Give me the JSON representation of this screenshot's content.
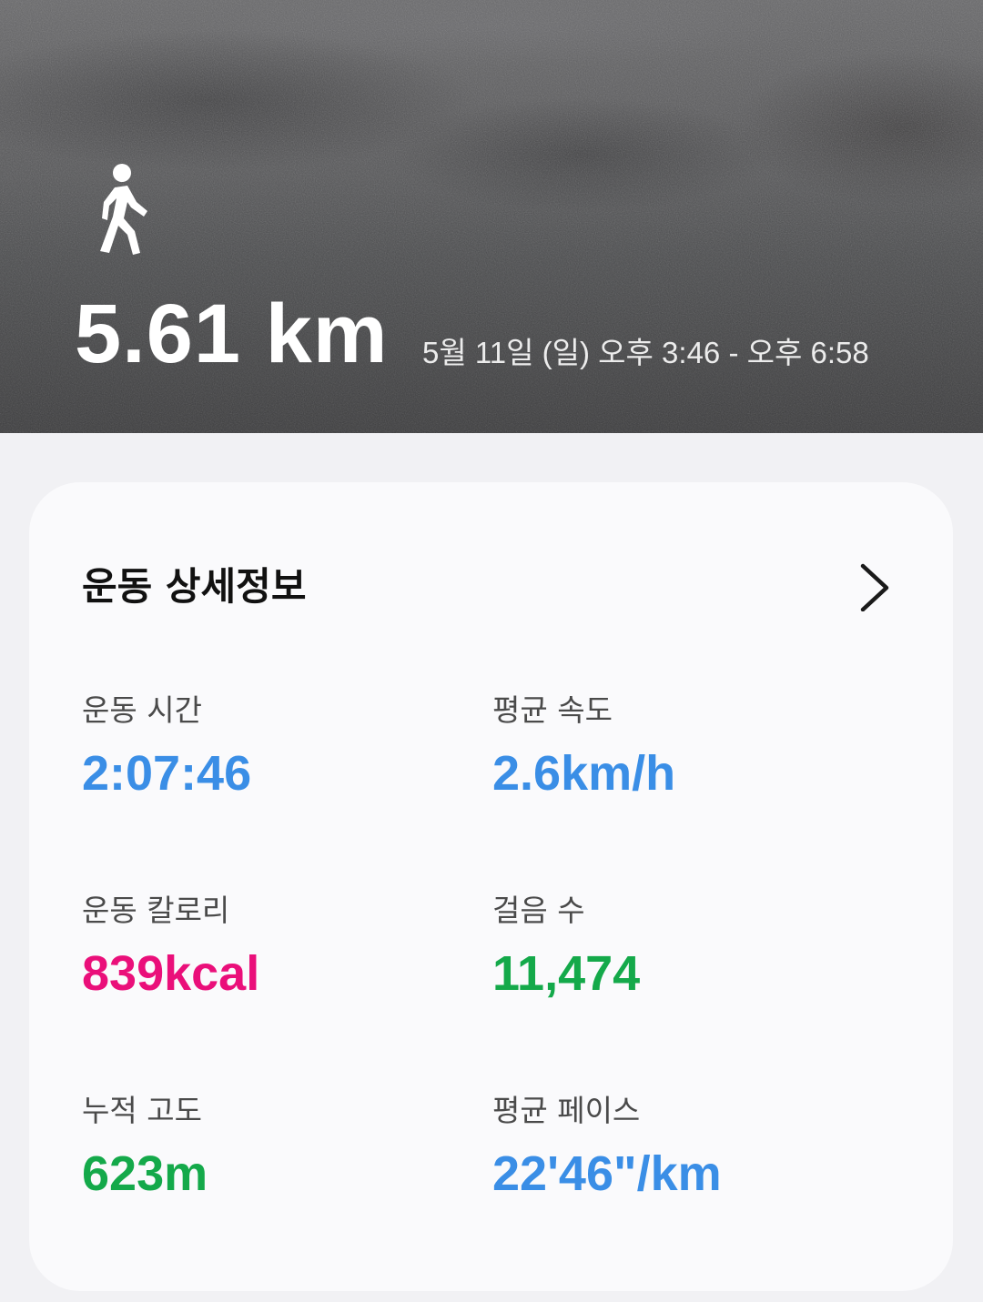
{
  "hero": {
    "activity_icon": "walking-person-icon",
    "distance": "5.61 km",
    "date_range": "5월 11일 (일) 오후 3:46 - 오후 6:58"
  },
  "details": {
    "title": "운동 상세정보",
    "more_icon": "chevron-right-icon",
    "metrics": [
      {
        "label": "운동 시간",
        "value": "2:07:46",
        "color": "#3a8ee6"
      },
      {
        "label": "평균 속도",
        "value": "2.6km/h",
        "color": "#3a8ee6"
      },
      {
        "label": "운동 칼로리",
        "value": "839kcal",
        "color": "#ea0f7a"
      },
      {
        "label": "걸음 수",
        "value": "11,474",
        "color": "#14a94a"
      },
      {
        "label": "누적 고도",
        "value": "623m",
        "color": "#14a94a"
      },
      {
        "label": "평균 페이스",
        "value": "22'46\"/km",
        "color": "#3a8ee6"
      }
    ]
  }
}
